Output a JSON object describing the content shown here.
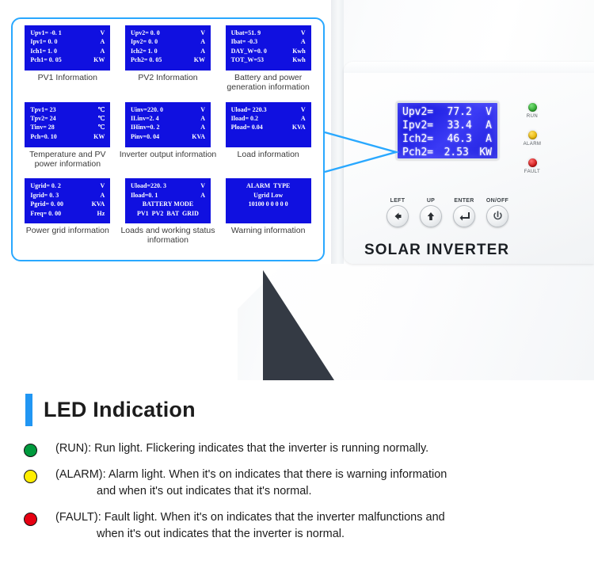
{
  "colors": {
    "accent_blue": "#29a8ff",
    "lcd_blue": "#1010e0",
    "title_bar": "#2196f3",
    "led_run_green": "#009a3d",
    "led_alarm_yellow": "#ffee00",
    "led_fault_red": "#e60012"
  },
  "info_panel": {
    "cells": [
      {
        "caption": "PV1 Information",
        "rows": [
          {
            "label": "Upv1= -0. 1",
            "unit": "V"
          },
          {
            "label": "Ipv1= 0. 0",
            "unit": "A"
          },
          {
            "label": "Ich1= 1. 0",
            "unit": "A"
          },
          {
            "label": "Pch1= 0. 05",
            "unit": "KW"
          }
        ]
      },
      {
        "caption": "PV2 Information",
        "rows": [
          {
            "label": "Upv2= 0. 0",
            "unit": "V"
          },
          {
            "label": "Ipv2= 0. 0",
            "unit": "A"
          },
          {
            "label": "Ich2= 1. 0",
            "unit": "A"
          },
          {
            "label": "Pch2= 0. 05",
            "unit": "KW"
          }
        ]
      },
      {
        "caption": "Battery and power generation information",
        "rows": [
          {
            "label": "Ubat=51. 9",
            "unit": "V"
          },
          {
            "label": "Ibat= -0.3",
            "unit": "A"
          },
          {
            "label": "DAY_W=0. 0",
            "unit": "Kwh"
          },
          {
            "label": "TOT_W=53",
            "unit": "Kwh"
          }
        ]
      },
      {
        "caption": "Temperature and PV power information",
        "rows": [
          {
            "label": "Tpv1= 23",
            "unit": "℃"
          },
          {
            "label": "Tpv2= 24",
            "unit": "℃"
          },
          {
            "label": "Tinv= 28",
            "unit": "℃"
          },
          {
            "label": "Pch=0. 10",
            "unit": "KW"
          }
        ]
      },
      {
        "caption": "Inverter output information",
        "rows": [
          {
            "label": "Uinv=220. 0",
            "unit": "V"
          },
          {
            "label": "ILinv=2. 4",
            "unit": "A"
          },
          {
            "label": "IHinv=0. 2",
            "unit": "A"
          },
          {
            "label": "Pinv=0. 04",
            "unit": "KVA"
          }
        ]
      },
      {
        "caption": "Load information",
        "rows": [
          {
            "label": "Uload= 220.3",
            "unit": "V"
          },
          {
            "label": "Iload= 0.2",
            "unit": "A"
          },
          {
            "label": "Pload= 0.04",
            "unit": "KVA"
          }
        ]
      },
      {
        "caption": "Power grid information",
        "rows": [
          {
            "label": "Ugrid= 0. 2",
            "unit": "V"
          },
          {
            "label": "Igrid= 0. 3",
            "unit": "A"
          },
          {
            "label": "Pgrid= 0. 00",
            "unit": "KVA"
          },
          {
            "label": "Freq= 0. 00",
            "unit": "Hz"
          }
        ]
      },
      {
        "caption": "Loads and working status information",
        "rows": [
          {
            "label": "Uload=220. 3",
            "unit": "V"
          },
          {
            "label": "Iload=0. 1",
            "unit": "A"
          },
          {
            "label": "BATTERY MODE",
            "unit": "",
            "center": true
          },
          {
            "label": "PV1  PV2  BAT  GRID",
            "unit": "",
            "center": true
          }
        ]
      },
      {
        "caption": "Warning information",
        "rows": [
          {
            "label": "ALARM  TYPE",
            "unit": "",
            "center": true
          },
          {
            "label": "Ugrid Low",
            "unit": "",
            "center": true
          },
          {
            "label": "10100 0 0 0 0 0",
            "unit": "",
            "center": true
          }
        ]
      }
    ]
  },
  "device": {
    "brand": "SOLAR INVERTER",
    "lcd_rows": [
      {
        "label": "Upv2=",
        "value": "77.2",
        "unit": "V"
      },
      {
        "label": "Ipv2=",
        "value": "33.4",
        "unit": "A"
      },
      {
        "label": "Ich2=",
        "value": "46.3",
        "unit": "A"
      },
      {
        "label": "Pch2=",
        "value": "2.53",
        "unit": "KW"
      }
    ],
    "leds": [
      {
        "name": "RUN",
        "color": "green"
      },
      {
        "name": "ALARM",
        "color": "yellow"
      },
      {
        "name": "FAULT",
        "color": "red"
      }
    ],
    "keys": [
      {
        "label": "LEFT",
        "icon": "arrow-left-icon"
      },
      {
        "label": "UP",
        "icon": "arrow-up-icon"
      },
      {
        "label": "ENTER",
        "icon": "enter-icon"
      },
      {
        "label": "ON/OFF",
        "icon": "power-icon"
      }
    ]
  },
  "led_section": {
    "title": "LED Indication",
    "items": [
      {
        "color": "green",
        "line1": "(RUN): Run light. Flickering indicates that the inverter is running normally.",
        "line2": ""
      },
      {
        "color": "yellow",
        "line1": "(ALARM): Alarm light. When it's on indicates that there is warning information",
        "line2": "and when it's out indicates that it's normal."
      },
      {
        "color": "red",
        "line1": "(FAULT): Fault light. When it's on indicates that the inverter malfunctions and",
        "line2": "when it's out indicates that the inverter is normal."
      }
    ]
  }
}
